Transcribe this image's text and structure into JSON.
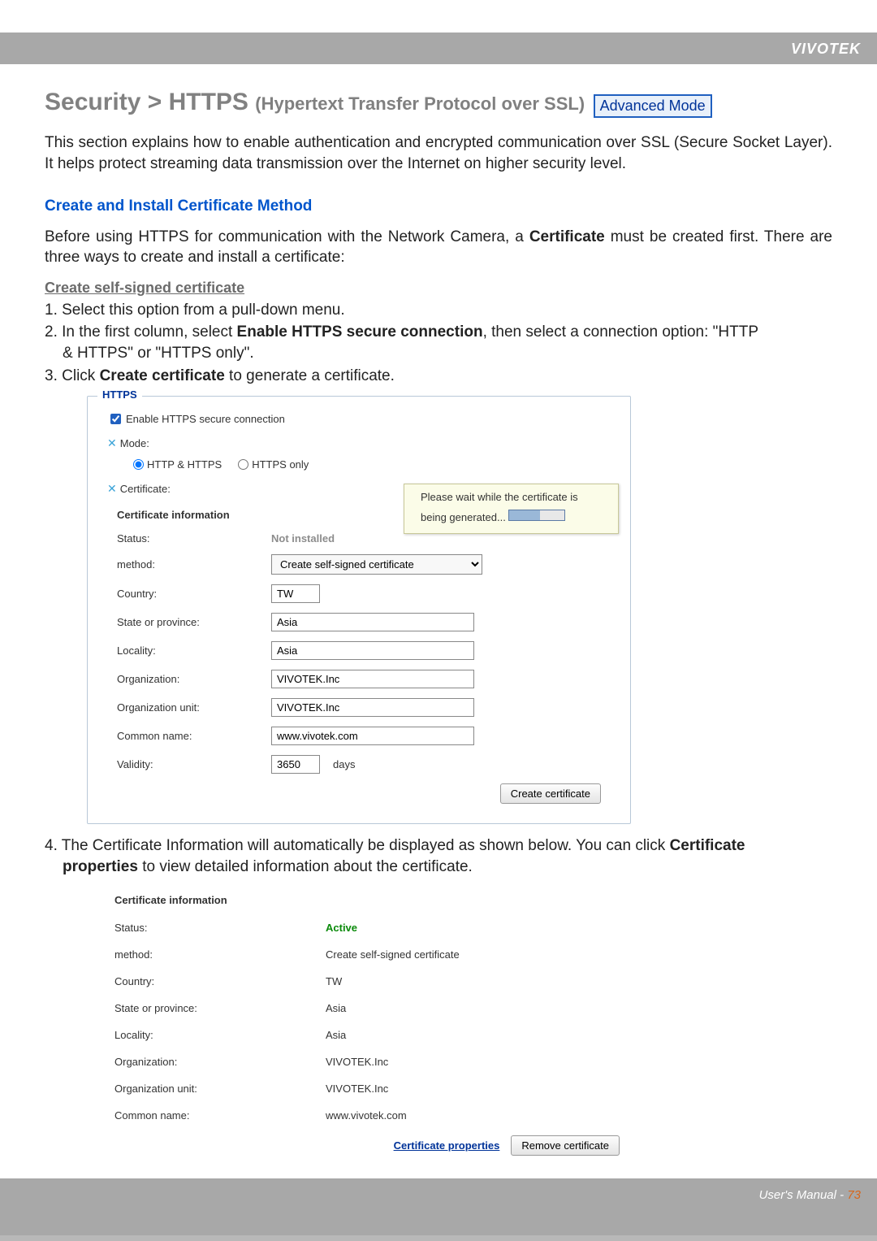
{
  "brand": "VIVOTEK",
  "title": {
    "main": "Security >  HTTPS ",
    "sub": "(Hypertext Transfer Protocol over SSL)",
    "badge": "Advanced Mode"
  },
  "intro": "This section explains how to enable authentication and encrypted communication over SSL (Secure Socket Layer). It helps protect streaming data transmission over the Internet on higher security level.",
  "section_heading": "Create and Install Certificate Method",
  "before_text_1": "Before using HTTPS for communication with the Network Camera, a ",
  "before_bold": "Certificate",
  "before_text_2": " must be created first. There are three ways to create and install a certificate:",
  "sub_heading": "Create self-signed certificate",
  "steps": {
    "s1": "1. Select this option from a pull-down menu.",
    "s2_a": "2. In the first column, select ",
    "s2_bold": "Enable HTTPS secure connection",
    "s2_b": ", then select a connection option: \"HTTP",
    "s2_line2": "& HTTPS\" or \"HTTPS only\".",
    "s3_a": "3. Click ",
    "s3_bold": "Create certificate",
    "s3_b": " to generate a certificate."
  },
  "panel": {
    "legend": "HTTPS",
    "enable_label": "Enable HTTPS secure connection",
    "mode_label": "Mode:",
    "radio1": "HTTP & HTTPS",
    "radio2": "HTTPS only",
    "cert_section": "Certificate:",
    "ci_header": "Certificate information",
    "rows": {
      "status_lbl": "Status:",
      "status_val": "Not installed",
      "method_lbl": "method:",
      "method_val": "Create self-signed certificate",
      "country_lbl": "Country:",
      "country_val": "TW",
      "state_lbl": "State or province:",
      "state_val": "Asia",
      "locality_lbl": "Locality:",
      "locality_val": "Asia",
      "org_lbl": "Organization:",
      "org_val": "VIVOTEK.Inc",
      "orgunit_lbl": "Organization unit:",
      "orgunit_val": "VIVOTEK.Inc",
      "cn_lbl": "Common name:",
      "cn_val": "www.vivotek.com",
      "validity_lbl": "Validity:",
      "validity_val": "3650",
      "validity_unit": "days"
    },
    "create_btn": "Create certificate"
  },
  "tooltip": "Please wait while the certificate is being generated...",
  "step4_a": "4. The Certificate Information will automatically be displayed as shown below. You can click ",
  "step4_bold": "Certificate",
  "step4_line2_bold": "properties",
  "step4_b": " to view detailed information about the certificate.",
  "info": {
    "header": "Certificate information",
    "status_lbl": "Status:",
    "status_val": "Active",
    "method_lbl": "method:",
    "method_val": "Create self-signed certificate",
    "country_lbl": "Country:",
    "country_val": "TW",
    "state_lbl": "State or province:",
    "state_val": "Asia",
    "locality_lbl": "Locality:",
    "locality_val": "Asia",
    "org_lbl": "Organization:",
    "org_val": "VIVOTEK.Inc",
    "orgunit_lbl": "Organization unit:",
    "orgunit_val": "VIVOTEK.Inc",
    "cn_lbl": "Common name:",
    "cn_val": "www.vivotek.com",
    "cert_props_link": "Certificate properties",
    "remove_btn": "Remove certificate"
  },
  "footer": {
    "label": "User's Manual - ",
    "page": "73"
  }
}
